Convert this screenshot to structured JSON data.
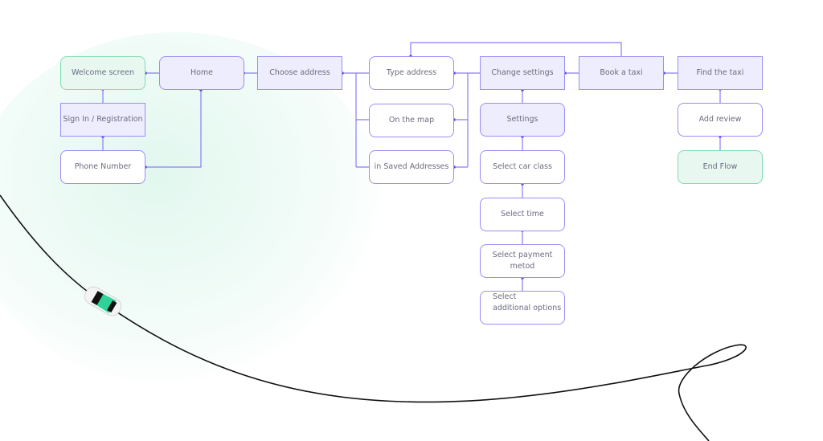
{
  "nodes": {
    "welcome": "Welcome screen",
    "home": "Home",
    "choose_address": "Choose address",
    "sign_in": "Sign In / Registration",
    "phone": "Phone Number",
    "type_address": "Type address",
    "on_map": "On the map",
    "saved": "in Saved Addresses",
    "change_settings": "Change settings",
    "settings": "Settings",
    "car_class": "Select car class",
    "time": "Select time",
    "payment": "Select payment metod",
    "additional_1": "Select",
    "additional_2": "additional options",
    "book": "Book a taxi",
    "find": "Find the taxi",
    "review": "Add review",
    "end": "End Flow"
  },
  "colors": {
    "connector": "#7b6cf6",
    "start_end": "#7fdcb4",
    "highlight": "#eeedfd",
    "car_accent": "#2fd39a"
  }
}
